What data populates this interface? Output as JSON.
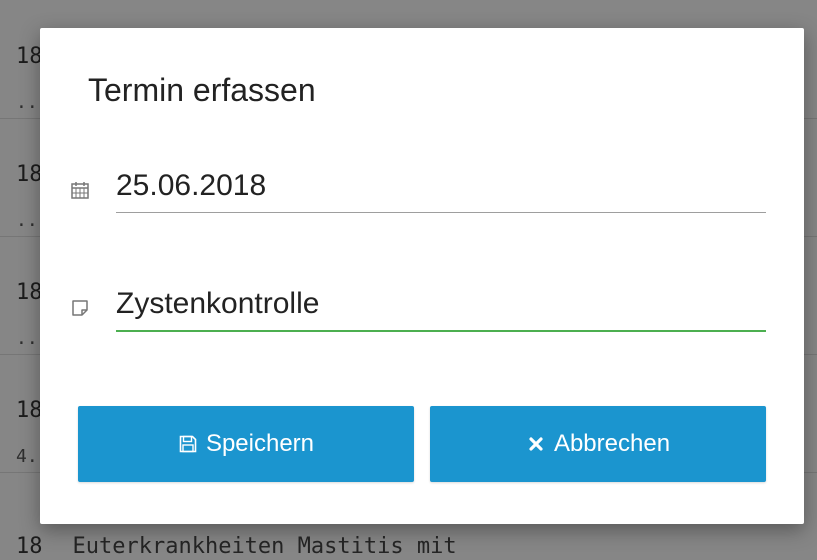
{
  "background": {
    "rows": [
      {
        "year": "18",
        "sub": "..."
      },
      {
        "year": "18",
        "sub": "..."
      },
      {
        "year": "18",
        "sub": "..."
      },
      {
        "year": "18",
        "sub": "4.."
      }
    ],
    "bottom_year": "18",
    "bottom_text": "Euterkrankheiten Mastitis mit"
  },
  "dialog": {
    "title": "Termin erfassen",
    "date_field": {
      "value": "25.06.2018",
      "icon": "calendar-icon"
    },
    "note_field": {
      "value": "Zystenkontrolle",
      "icon": "note-icon"
    },
    "save_label": "Speichern",
    "cancel_label": "Abbrechen",
    "save_icon": "floppy-disk-icon",
    "cancel_icon": "close-icon"
  },
  "colors": {
    "button": "#1b95cf",
    "focus_underline": "#4caf50",
    "underline": "#9e9e9e"
  }
}
